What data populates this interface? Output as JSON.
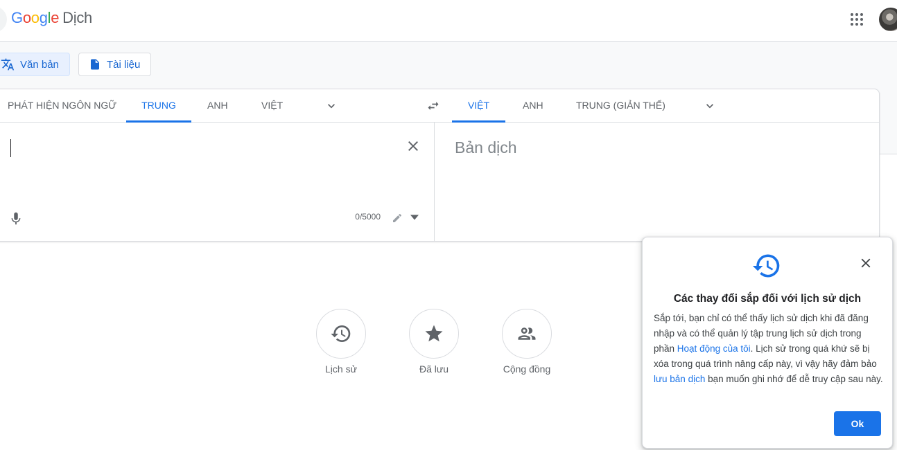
{
  "header": {
    "logo_letters": [
      "G",
      "o",
      "o",
      "g",
      "l",
      "e"
    ],
    "product": "Dịch"
  },
  "modes": {
    "text_label": "Văn bản",
    "docs_label": "Tài liệu"
  },
  "source_langs": {
    "detect": "PHÁT HIỆN NGÔN NGỮ",
    "items": [
      "TRUNG",
      "ANH",
      "VIỆT"
    ],
    "selected": "TRUNG"
  },
  "target_langs": {
    "items": [
      "VIỆT",
      "ANH",
      "TRUNG (GIẢN THỂ)"
    ],
    "selected": "VIỆT"
  },
  "input": {
    "value": "",
    "char_count": "0/5000"
  },
  "output": {
    "placeholder": "Bản dịch"
  },
  "bottom_actions": [
    {
      "label": "Lịch sử",
      "icon": "history-icon"
    },
    {
      "label": "Đã lưu",
      "icon": "star-icon"
    },
    {
      "label": "Cộng đồng",
      "icon": "community-icon"
    }
  ],
  "popup": {
    "title": "Các thay đổi sắp đối với lịch sử dịch",
    "body_1": "Sắp tới, bạn chỉ có thể thấy lịch sử dịch khi đã đăng nhập và có thể quản lý tập trung lịch sử dịch trong phần ",
    "link_1": "Hoạt động của tôi",
    "body_2": ". Lịch sử trong quá khứ sẽ bị xóa trong quá trình nâng cấp này, vì vậy hãy đảm bảo ",
    "link_2": "lưu bản dịch",
    "body_3": " bạn muốn ghi nhớ để dễ truy cập sau này.",
    "ok_label": "Ok"
  },
  "colors": {
    "accent": "#1a73e8",
    "border": "#dadce0",
    "band": "#f8f9fa"
  }
}
